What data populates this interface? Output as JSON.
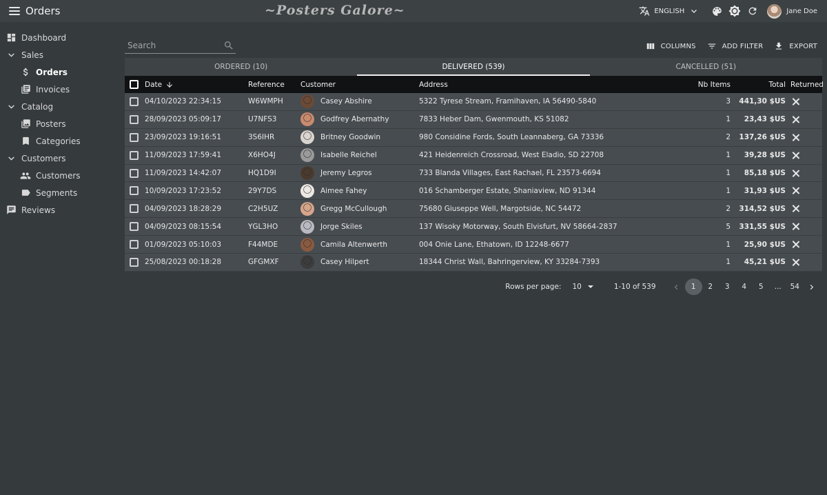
{
  "appbar": {
    "title": "Orders",
    "brand": "~Posters Galore~",
    "language": "ENGLISH",
    "user_name": "Jane Doe"
  },
  "sidebar": {
    "items": [
      {
        "label": "Dashboard",
        "icon": "dashboard-icon",
        "level": 0
      },
      {
        "label": "Sales",
        "icon": "chevron-down-icon",
        "level": 0
      },
      {
        "label": "Orders",
        "icon": "dollar-icon",
        "level": 1,
        "active": true
      },
      {
        "label": "Invoices",
        "icon": "invoices-icon",
        "level": 1
      },
      {
        "label": "Catalog",
        "icon": "chevron-down-icon",
        "level": 0
      },
      {
        "label": "Posters",
        "icon": "image-icon",
        "level": 1
      },
      {
        "label": "Categories",
        "icon": "bookmark-icon",
        "level": 1
      },
      {
        "label": "Customers",
        "icon": "chevron-down-icon",
        "level": 0
      },
      {
        "label": "Customers",
        "icon": "people-icon",
        "level": 1
      },
      {
        "label": "Segments",
        "icon": "label-icon",
        "level": 1
      },
      {
        "label": "Reviews",
        "icon": "comment-icon",
        "level": 0
      }
    ]
  },
  "search": {
    "placeholder": "Search",
    "value": ""
  },
  "toolbar": {
    "columns": "COLUMNS",
    "add_filter": "ADD FILTER",
    "export": "EXPORT"
  },
  "tabs": [
    {
      "label": "ORDERED (10)",
      "active": false
    },
    {
      "label": "DELIVERED (539)",
      "active": true
    },
    {
      "label": "CANCELLED (51)",
      "active": false
    }
  ],
  "table": {
    "headers": {
      "date": "Date",
      "reference": "Reference",
      "customer": "Customer",
      "address": "Address",
      "nb_items": "Nb Items",
      "total": "Total",
      "returned": "Returned"
    },
    "rows": [
      {
        "date": "04/10/2023 22:34:15",
        "reference": "W6WMPH",
        "customer": "Casey Abshire",
        "address": "5322 Tyrese Stream, Framihaven, IA 56490-5840",
        "nb_items": "3",
        "total": "441,30 $US",
        "avatar_color": "#6b4a36"
      },
      {
        "date": "28/09/2023 05:09:17",
        "reference": "U7NFS3",
        "customer": "Godfrey Abernathy",
        "address": "7833 Heber Dam, Gwenmouth, KS 51082",
        "nb_items": "1",
        "total": "23,43 $US",
        "avatar_color": "#c98a6e"
      },
      {
        "date": "23/09/2023 19:16:51",
        "reference": "3S6IHR",
        "customer": "Britney Goodwin",
        "address": "980 Considine Fords, South Leannaberg, GA 73336",
        "nb_items": "2",
        "total": "137,26 $US",
        "avatar_color": "#d9d4cf"
      },
      {
        "date": "11/09/2023 17:59:41",
        "reference": "X6HO4J",
        "customer": "Isabelle Reichel",
        "address": "421 Heidenreich Crossroad, West Eladio, SD 22708",
        "nb_items": "1",
        "total": "39,28 $US",
        "avatar_color": "#9a9a9a"
      },
      {
        "date": "11/09/2023 14:42:07",
        "reference": "HQ1D9I",
        "customer": "Jeremy Legros",
        "address": "733 Blanda Villages, East Rachael, FL 23573-6694",
        "nb_items": "1",
        "total": "85,18 $US",
        "avatar_color": "#4a3a2e"
      },
      {
        "date": "10/09/2023 17:23:52",
        "reference": "29Y7DS",
        "customer": "Aimee Fahey",
        "address": "016 Schamberger Estate, Shaniaview, ND 91344",
        "nb_items": "1",
        "total": "31,93 $US",
        "avatar_color": "#ece8e4"
      },
      {
        "date": "04/09/2023 18:28:29",
        "reference": "C2H5UZ",
        "customer": "Gregg McCullough",
        "address": "75680 Giuseppe Well, Margotside, NC 54472",
        "nb_items": "2",
        "total": "314,52 $US",
        "avatar_color": "#d6a58a"
      },
      {
        "date": "04/09/2023 08:15:54",
        "reference": "YGL3HO",
        "customer": "Jorge Skiles",
        "address": "137 Wisoky Motorway, South Elvisfurt, NV 58664-2837",
        "nb_items": "5",
        "total": "331,55 $US",
        "avatar_color": "#b9b9c2"
      },
      {
        "date": "01/09/2023 05:10:03",
        "reference": "F44MDE",
        "customer": "Camila Altenwerth",
        "address": "004 Onie Lane, Ethatown, ID 12248-6677",
        "nb_items": "1",
        "total": "25,90 $US",
        "avatar_color": "#8a5a40"
      },
      {
        "date": "25/08/2023 00:18:28",
        "reference": "GFGMXF",
        "customer": "Casey Hilpert",
        "address": "18344 Christ Wall, Bahringerview, KY 33284-7393",
        "nb_items": "1",
        "total": "45,21 $US",
        "avatar_color": "#3c3c3c"
      }
    ]
  },
  "pagination": {
    "rows_per_page_label": "Rows per page:",
    "rows_per_page": "10",
    "range": "1-10 of 539",
    "pages": [
      "1",
      "2",
      "3",
      "4",
      "5",
      "...",
      "54"
    ],
    "current_page": "1"
  }
}
